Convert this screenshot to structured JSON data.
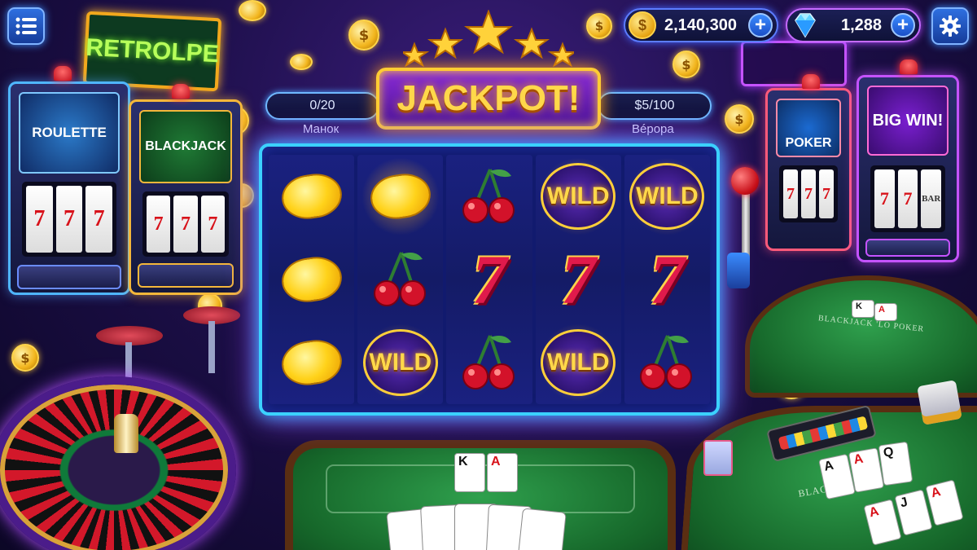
{
  "hud": {
    "menu_icon": "hamburger-menu-icon",
    "coins_value": "2,140,300",
    "gems_value": "1,288",
    "plus_label": "+",
    "settings_icon": "gear-icon",
    "coin_symbol": "$"
  },
  "signs": {
    "retrolpe": "RETROLPE",
    "big_win": "BIG WIN!"
  },
  "machines": {
    "roulette_label": "ROULETTE",
    "blackjack_label": "BLACKJACK",
    "poker_label": "POKER",
    "reel_symbol": "7",
    "bar_label": "BAR",
    "wild_mini": "WILD"
  },
  "jackpot": {
    "title": "JACKPOT!",
    "left_counter": "0/20",
    "left_label": "Манок",
    "right_counter": "$5/100",
    "right_label": "Вépopa"
  },
  "reels": [
    [
      "lemon",
      "lemon",
      "lemon"
    ],
    [
      "lemon",
      "cherry",
      "wild"
    ],
    [
      "cherry",
      "seven",
      "cherry"
    ],
    [
      "wild",
      "seven",
      "wild"
    ],
    [
      "wild",
      "seven",
      "cherry"
    ]
  ],
  "reel_glow": [
    [
      false,
      false,
      false
    ],
    [
      true,
      false,
      true
    ],
    [
      false,
      false,
      false
    ],
    [
      true,
      false,
      true
    ],
    [
      true,
      false,
      false
    ]
  ],
  "symbols": {
    "wild": "WILD",
    "seven": "7"
  },
  "tables": {
    "blackjack_felt_text": "BLACKJACK",
    "poker_felt_text": "BLACKJACK 'LO POKER"
  },
  "hand_cards": [
    "A",
    "J",
    "Q",
    "A",
    "A"
  ],
  "dealer_cards": [
    "K",
    "A"
  ],
  "colors": {
    "neon_cyan": "#3bd1ff",
    "neon_purple": "#a04dff",
    "gold": "#ffcc33",
    "felt_green": "#1f7a35"
  }
}
